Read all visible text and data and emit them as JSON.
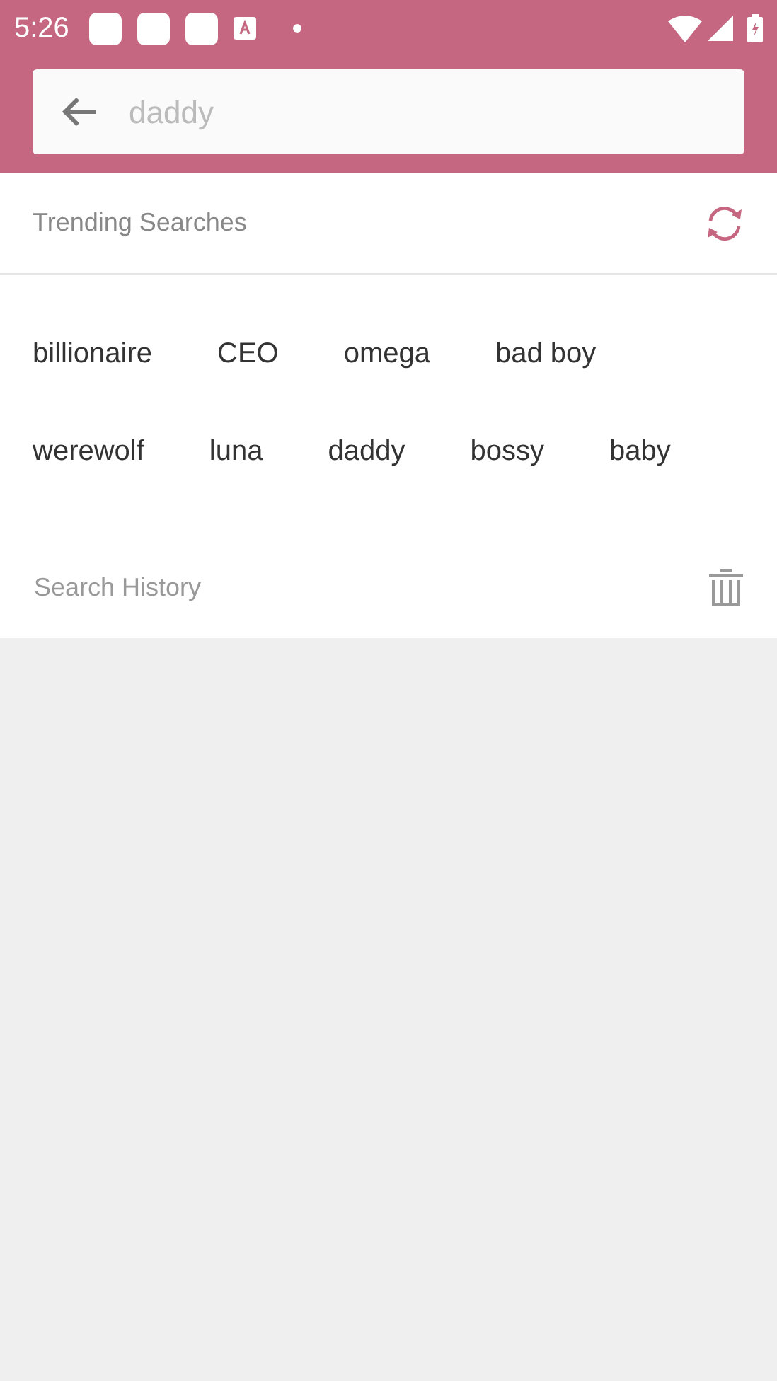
{
  "status_bar": {
    "time": "5:26"
  },
  "search": {
    "placeholder": "daddy"
  },
  "trending": {
    "title": "Trending Searches",
    "tags": [
      "billionaire",
      "CEO",
      "omega",
      "bad boy",
      "werewolf",
      "luna",
      "daddy",
      "bossy",
      "baby"
    ]
  },
  "history": {
    "title": "Search History"
  }
}
